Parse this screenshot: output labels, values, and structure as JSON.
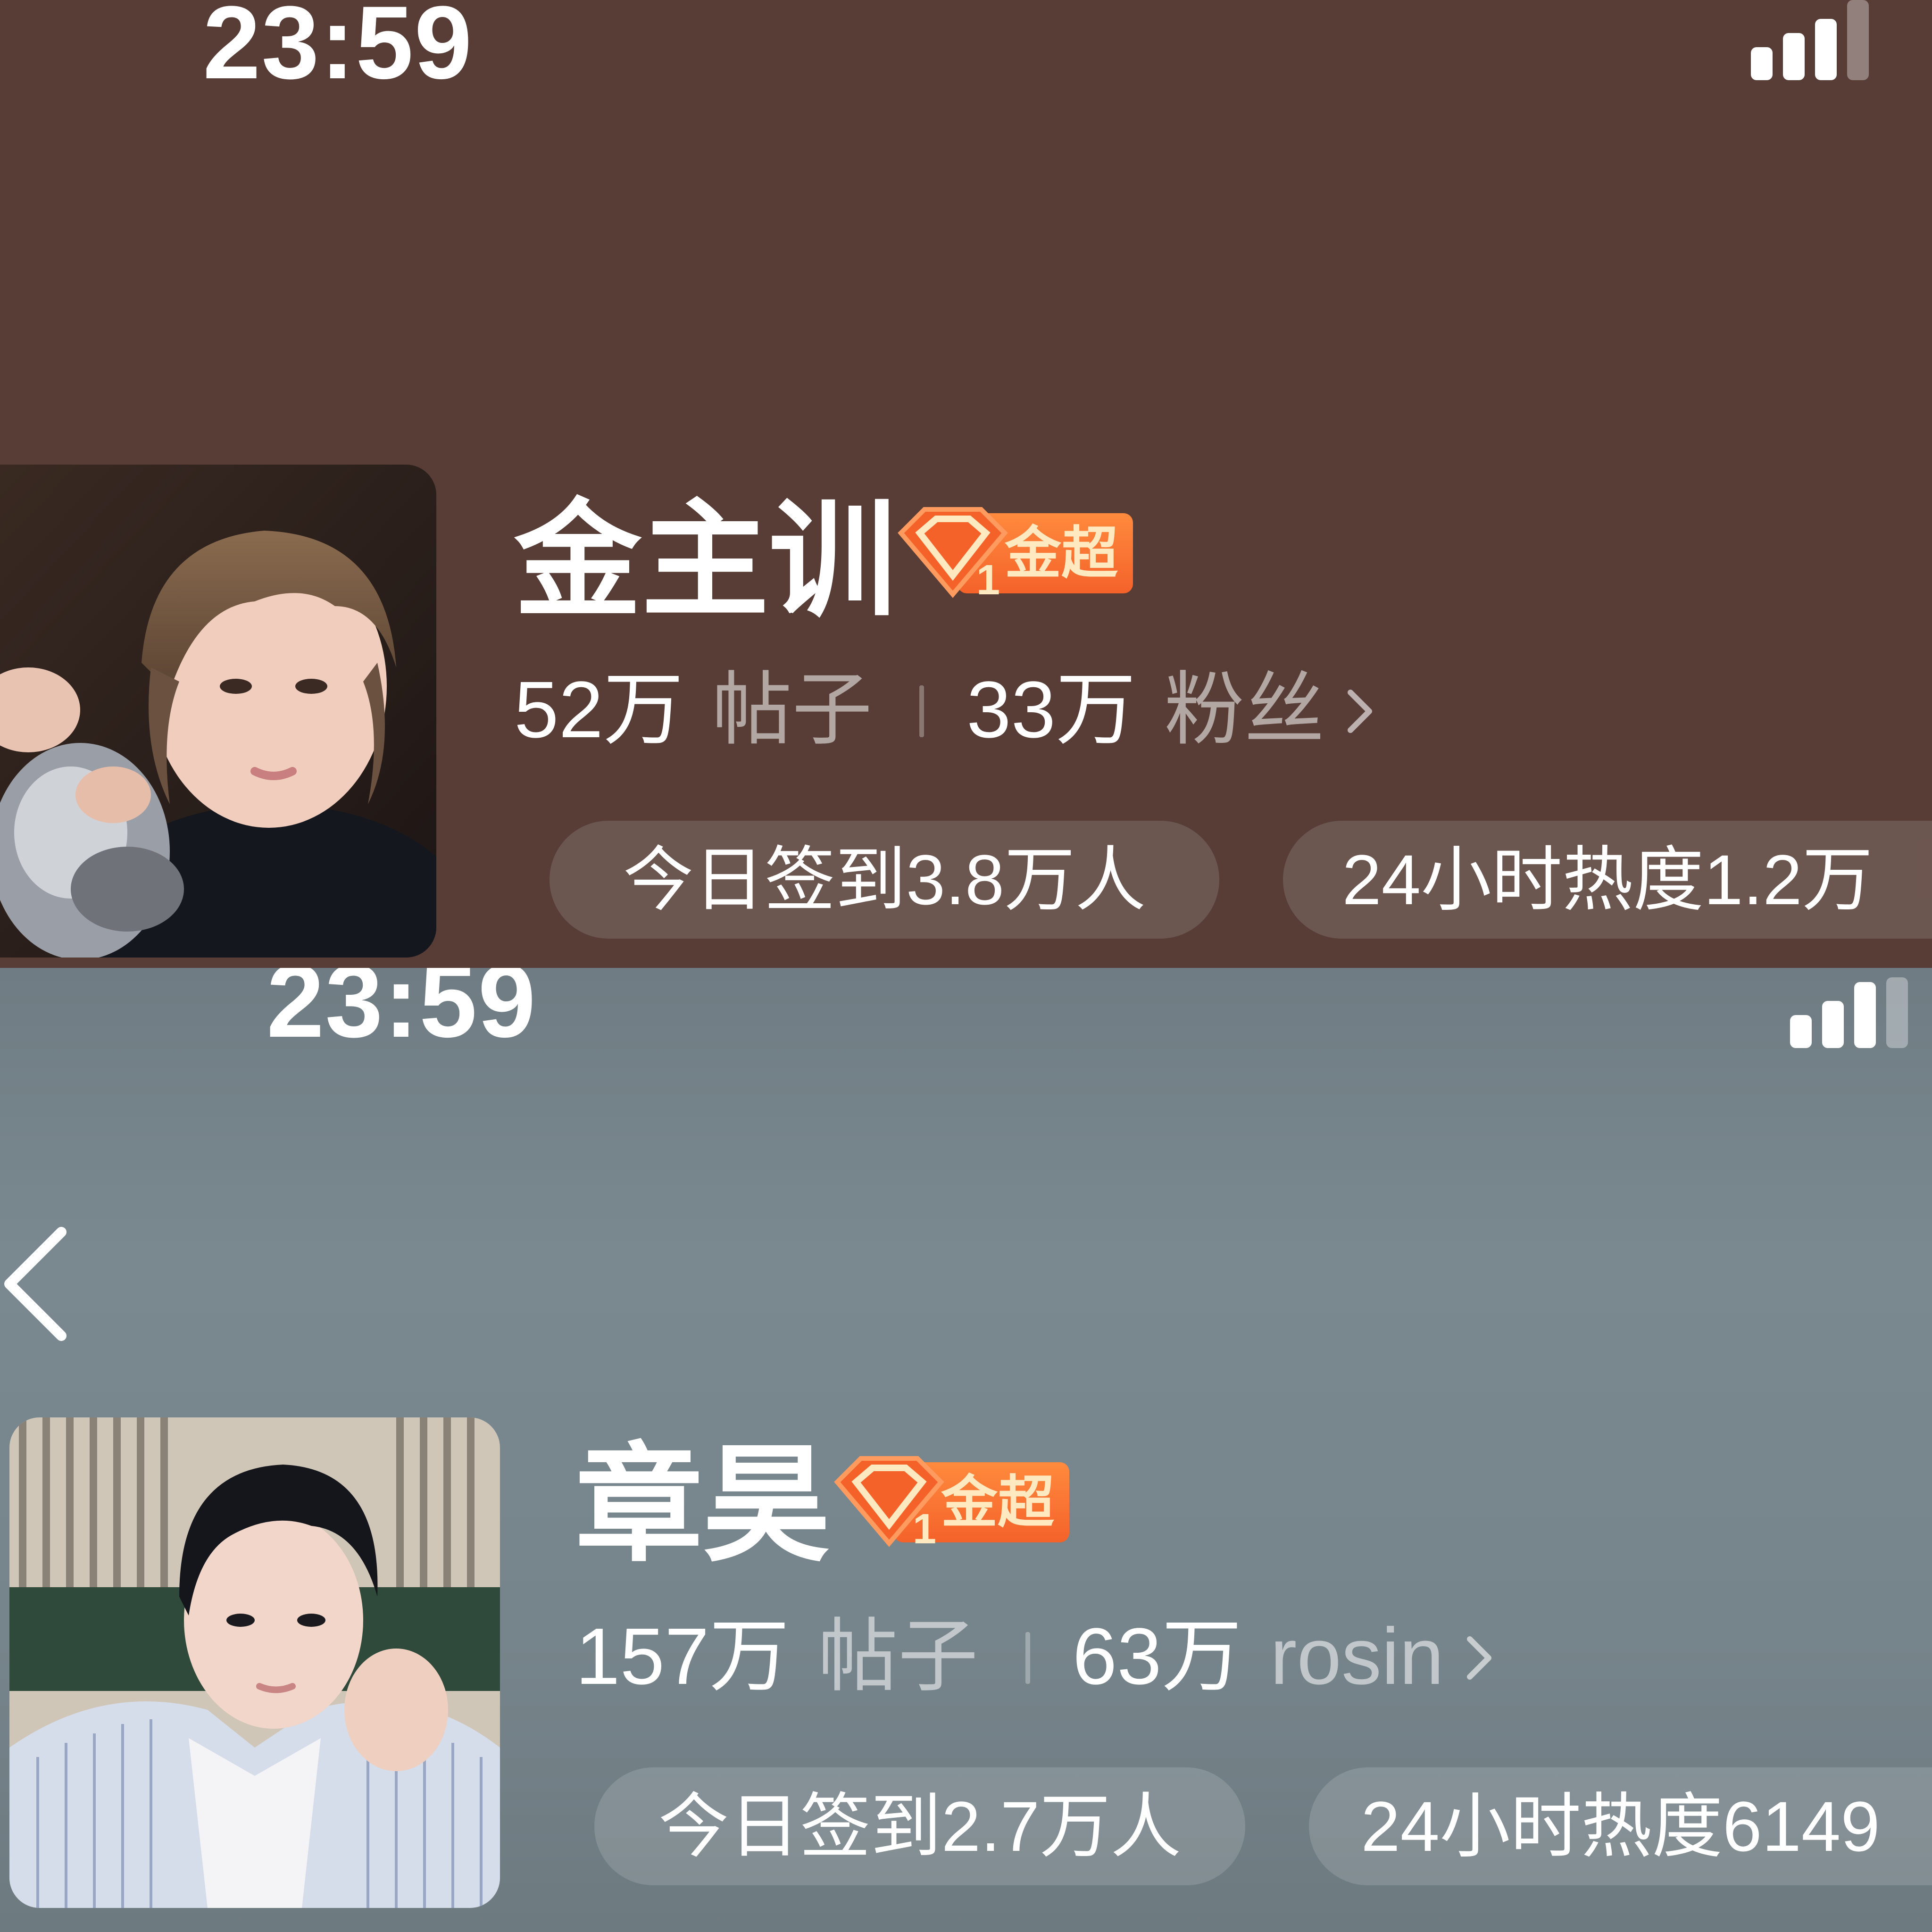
{
  "top": {
    "status_time": "23:59",
    "name": "金主训",
    "badge_label": "金超",
    "badge_rank": "1",
    "posts_count": "52万",
    "posts_label": "帖子",
    "followers_count": "33万",
    "followers_label": "粉丝",
    "checkin": "今日签到3.8万人",
    "heat": "24小时热度1.2万",
    "bg_color": "#573d36"
  },
  "bottom": {
    "status_time": "23:59",
    "name": "章昊",
    "badge_label": "金超",
    "badge_rank": "1",
    "posts_count": "157万",
    "posts_label": "帖子",
    "followers_count": "63万",
    "followers_label": "rosin",
    "checkin": "今日签到2.7万人",
    "heat": "24小时热度6149",
    "bg_color": "#77858c"
  },
  "icons": {
    "signal": "signal-icon",
    "back": "chevron-left-icon",
    "more": "chevron-right-icon",
    "badge": "diamond-gem-icon"
  },
  "colors": {
    "badge_orange": "#f4622a",
    "badge_text": "#ffe9c0"
  }
}
